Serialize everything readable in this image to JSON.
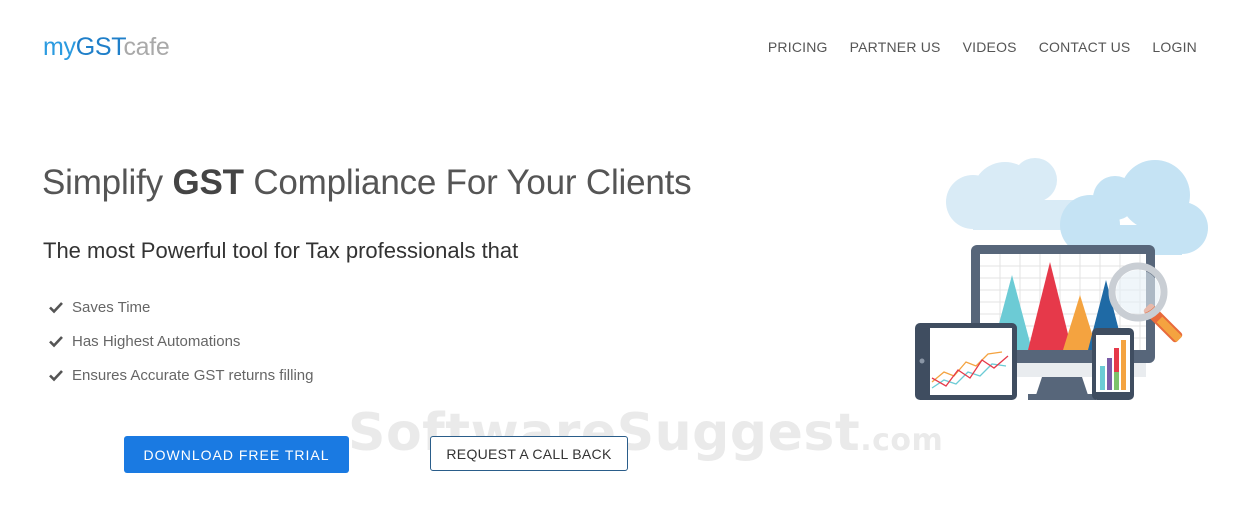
{
  "logo": {
    "part1": "my",
    "part2": "GST",
    "part3": "cafe"
  },
  "nav": {
    "items": [
      {
        "label": "PRICING"
      },
      {
        "label": "PARTNER US"
      },
      {
        "label": "VIDEOS"
      },
      {
        "label": "CONTACT US"
      },
      {
        "label": "LOGIN"
      }
    ]
  },
  "hero": {
    "title_prefix": "Simplify ",
    "title_strong": "GST",
    "title_suffix": " Compliance For Your Clients",
    "subtitle": "The most Powerful tool for Tax professionals that",
    "features": [
      {
        "text": "Saves Time"
      },
      {
        "text": "Has Highest Automations"
      },
      {
        "text": "Ensures Accurate GST returns filling"
      }
    ]
  },
  "buttons": {
    "download": "DOWNLOAD FREE TRIAL",
    "callback": "REQUEST A CALL BACK"
  },
  "watermark": {
    "text": "SoftwareSuggest",
    "domain": ".com"
  },
  "colors": {
    "brand_blue": "#1f7fc9",
    "button_blue": "#1a7ae2",
    "logo_grey": "#a9a9a9"
  },
  "icons": {
    "feature": "check-icon",
    "illustration": "devices-analytics-illustration"
  }
}
